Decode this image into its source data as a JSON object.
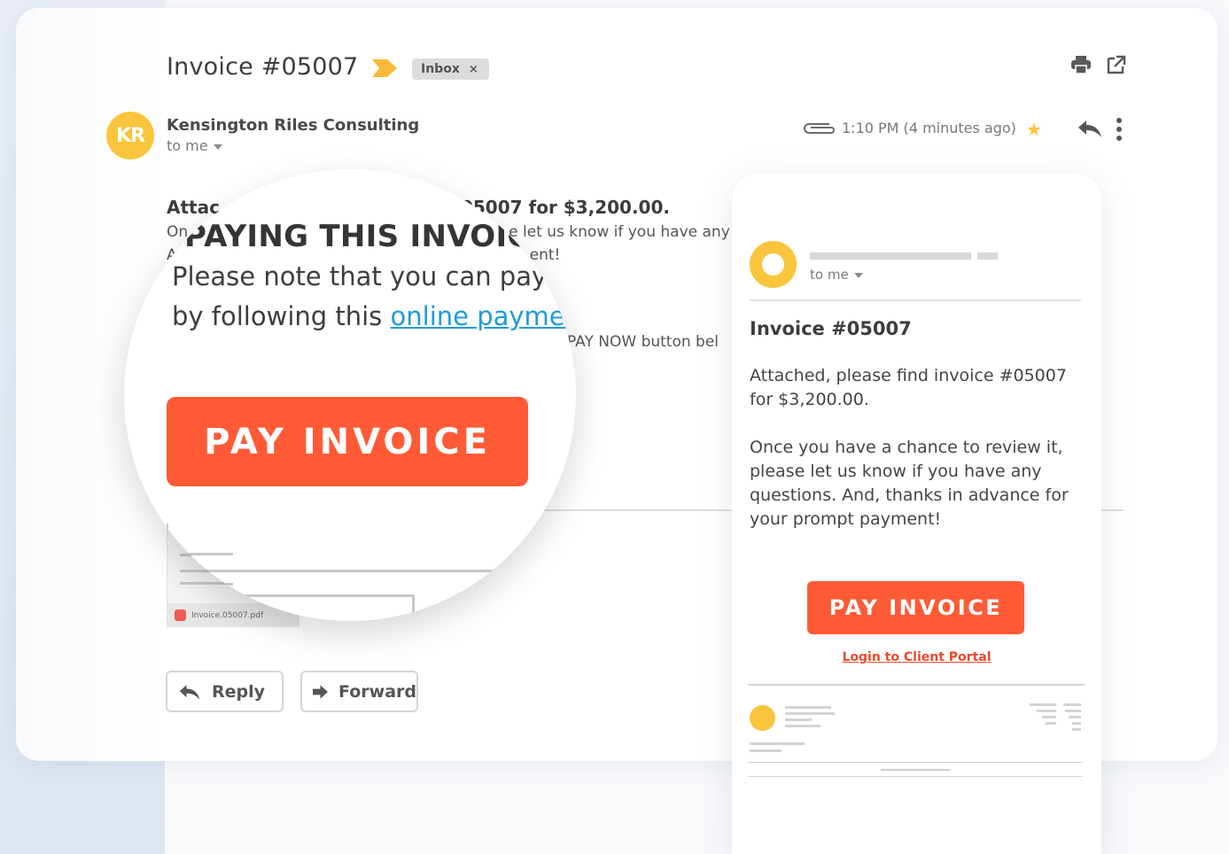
{
  "email": {
    "subject": "Invoice #05007",
    "label_chip": "Inbox",
    "label_chip_close": "×",
    "sender_initials": "KR",
    "sender_name": "Kensington Riles Consulting",
    "recipient": "to me",
    "timestamp": "1:10 PM (4 minutes ago)",
    "body_line1_a": "Attac",
    "body_line1_b": "05007 for $3,200.00.",
    "body_line2_a": "On",
    "body_line2_b": "e let us know if you have any c",
    "body_line3_a": "A",
    "body_line3_b": "ent!",
    "body_line4": "PAY NOW button bel",
    "attachment_name": "Invoice.05007.pdf",
    "reply_label": "Reply",
    "forward_label": "Forward"
  },
  "magnifier": {
    "heading": "PAYING THIS INVOICE",
    "line1": "Please note that you can pay",
    "line2_text": "by following this ",
    "line2_link": "online payment",
    "button": "PAY INVOICE"
  },
  "phone": {
    "recipient": "to me",
    "title": "Invoice #05007",
    "para1": "Attached, please find invoice #05007 for $3,200.00.",
    "para2": "Once you have a chance to review it, please let us know if you have any questions. And, thanks in advance for your prompt payment!",
    "button": "PAY INVOICE",
    "portal_link": "Login to Client Portal"
  },
  "colors": {
    "accent_orange": "#ff5a36",
    "avatar_yellow": "#f9c53c",
    "link_blue": "#1f9bd7"
  },
  "icons": [
    "label-arrow-icon",
    "print-icon",
    "open-external-icon",
    "attachment-clip-icon",
    "star-icon",
    "reply-icon",
    "more-vert-icon",
    "forward-icon"
  ]
}
